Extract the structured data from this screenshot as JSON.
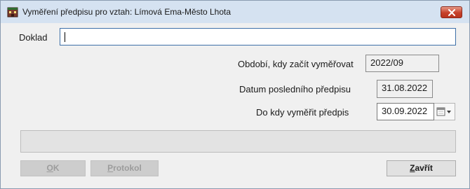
{
  "window": {
    "title": "Vyměření předpisu pro vztah: Límová Ema-Město Lhota",
    "app_icon": "building-icon",
    "close_icon": "close-icon"
  },
  "form": {
    "doklad": {
      "label": "Doklad",
      "value": ""
    },
    "obdobi": {
      "label": "Období, kdy začít vyměřovat",
      "value": "2022/09"
    },
    "datum_posledniho": {
      "label": "Datum posledního předpisu",
      "value": "31.08.2022"
    },
    "do_kdy": {
      "label": "Do kdy vyměřit předpis",
      "value": "30.09.2022",
      "picker_icon": "calendar-dropdown-icon"
    }
  },
  "progress": {
    "value": 0
  },
  "buttons": {
    "ok": {
      "label_first": "O",
      "label_rest": "K",
      "enabled": false
    },
    "protokol": {
      "label_first": "P",
      "label_rest": "rotokol",
      "enabled": false
    },
    "zavrit": {
      "label_first": "Z",
      "label_rest": "avřít",
      "enabled": true
    }
  },
  "colors": {
    "titlebar": "#d5e2f1",
    "close_button": "#c7402a",
    "focus_border": "#3d6fa8"
  }
}
